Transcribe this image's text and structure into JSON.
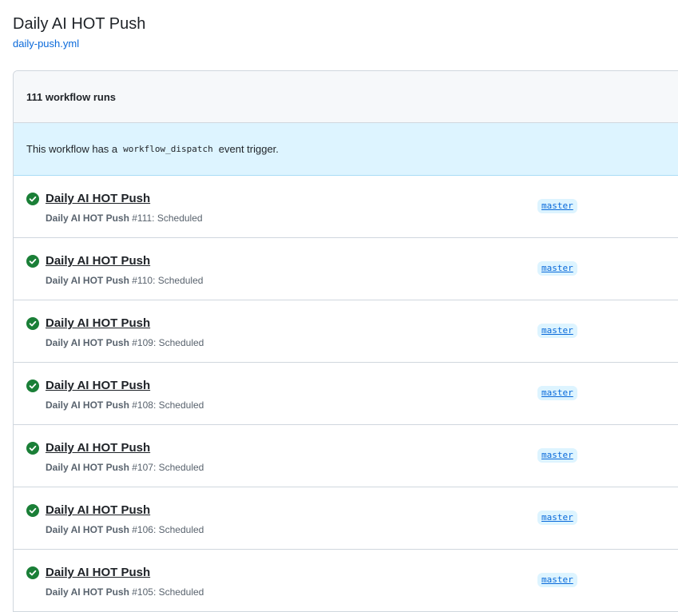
{
  "header": {
    "title": "Daily AI HOT Push",
    "workflow_file": "daily-push.yml"
  },
  "runs_summary": {
    "count_label": "111 workflow runs"
  },
  "dispatch_banner": {
    "prefix": "This workflow has a",
    "code": "workflow_dispatch",
    "suffix": "event trigger."
  },
  "runs": [
    {
      "title": "Daily AI HOT Push",
      "workflow_name": "Daily AI HOT Push",
      "run_number": "#111",
      "event": ": Scheduled",
      "branch": "master",
      "status": "success"
    },
    {
      "title": "Daily AI HOT Push",
      "workflow_name": "Daily AI HOT Push",
      "run_number": "#110",
      "event": ": Scheduled",
      "branch": "master",
      "status": "success"
    },
    {
      "title": "Daily AI HOT Push",
      "workflow_name": "Daily AI HOT Push",
      "run_number": "#109",
      "event": ": Scheduled",
      "branch": "master",
      "status": "success"
    },
    {
      "title": "Daily AI HOT Push",
      "workflow_name": "Daily AI HOT Push",
      "run_number": "#108",
      "event": ": Scheduled",
      "branch": "master",
      "status": "success"
    },
    {
      "title": "Daily AI HOT Push",
      "workflow_name": "Daily AI HOT Push",
      "run_number": "#107",
      "event": ": Scheduled",
      "branch": "master",
      "status": "success"
    },
    {
      "title": "Daily AI HOT Push",
      "workflow_name": "Daily AI HOT Push",
      "run_number": "#106",
      "event": ": Scheduled",
      "branch": "master",
      "status": "success"
    },
    {
      "title": "Daily AI HOT Push",
      "workflow_name": "Daily AI HOT Push",
      "run_number": "#105",
      "event": ": Scheduled",
      "branch": "master",
      "status": "success"
    }
  ],
  "icons": {
    "status_success": "check-circle-fill-icon"
  },
  "colors": {
    "success": "#1a7f37",
    "link": "#0969da",
    "banner_bg": "#ddf4ff",
    "header_bg": "#f6f8fa",
    "border": "#d0d7de"
  }
}
